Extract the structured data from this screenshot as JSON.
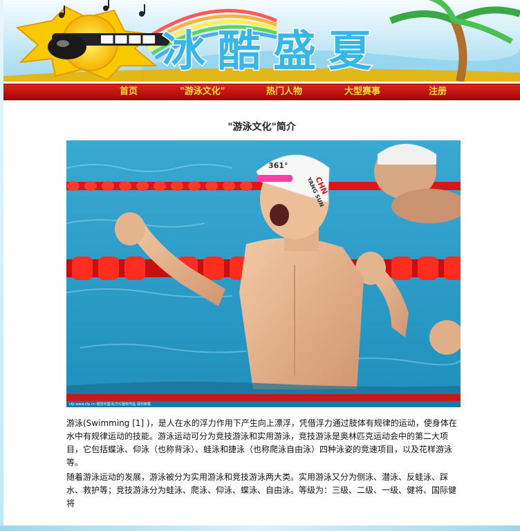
{
  "banner": {
    "title": "冰酷盛夏"
  },
  "nav": {
    "items": [
      "首页",
      "\"游泳文化\"",
      "热门人物",
      "大型赛事",
      "注册"
    ]
  },
  "article": {
    "title": "\"游泳文化\"简介",
    "photo": {
      "cap_text": "361°",
      "cap_country": "CHN",
      "cap_name": "YANG SUN",
      "watermark": "cfp www.cfp.cn 视觉中国/东方IC版权作品 请勿转载"
    },
    "paragraph1": "游泳(Swimming [1] )，是人在水的浮力作用下产生向上漂浮，凭借浮力通过肢体有规律的运动，使身体在水中有规律运动的技能。游泳运动可分为竞技游泳和实用游泳，竞技游泳是奥林匹克运动会中的第二大项目，它包括蝶泳、仰泳（也称背泳）、蛙泳和捷泳（也称爬泳自由泳）四种泳姿的竞速项目，以及花样游泳等。",
    "paragraph2": "随着游泳运动的发展，游泳被分为实用游泳和竞技游泳两大类。实用游泳又分为侧泳、潜泳、反蛙泳、踩水、救护等；竞技游泳分为蛙泳、爬泳、仰泳、蝶泳、自由泳。等级为：三级、二级、一级、健将、国际健将"
  },
  "colors": {
    "nav_bg": "#c40d0d",
    "nav_text": "#ffe236",
    "pool": "#2fa3c8",
    "lane_float": "#e01818"
  },
  "icons": [
    "sun-with-sunglasses-icon",
    "rainbow-icon",
    "palm-tree-icon",
    "music-note-icon"
  ]
}
